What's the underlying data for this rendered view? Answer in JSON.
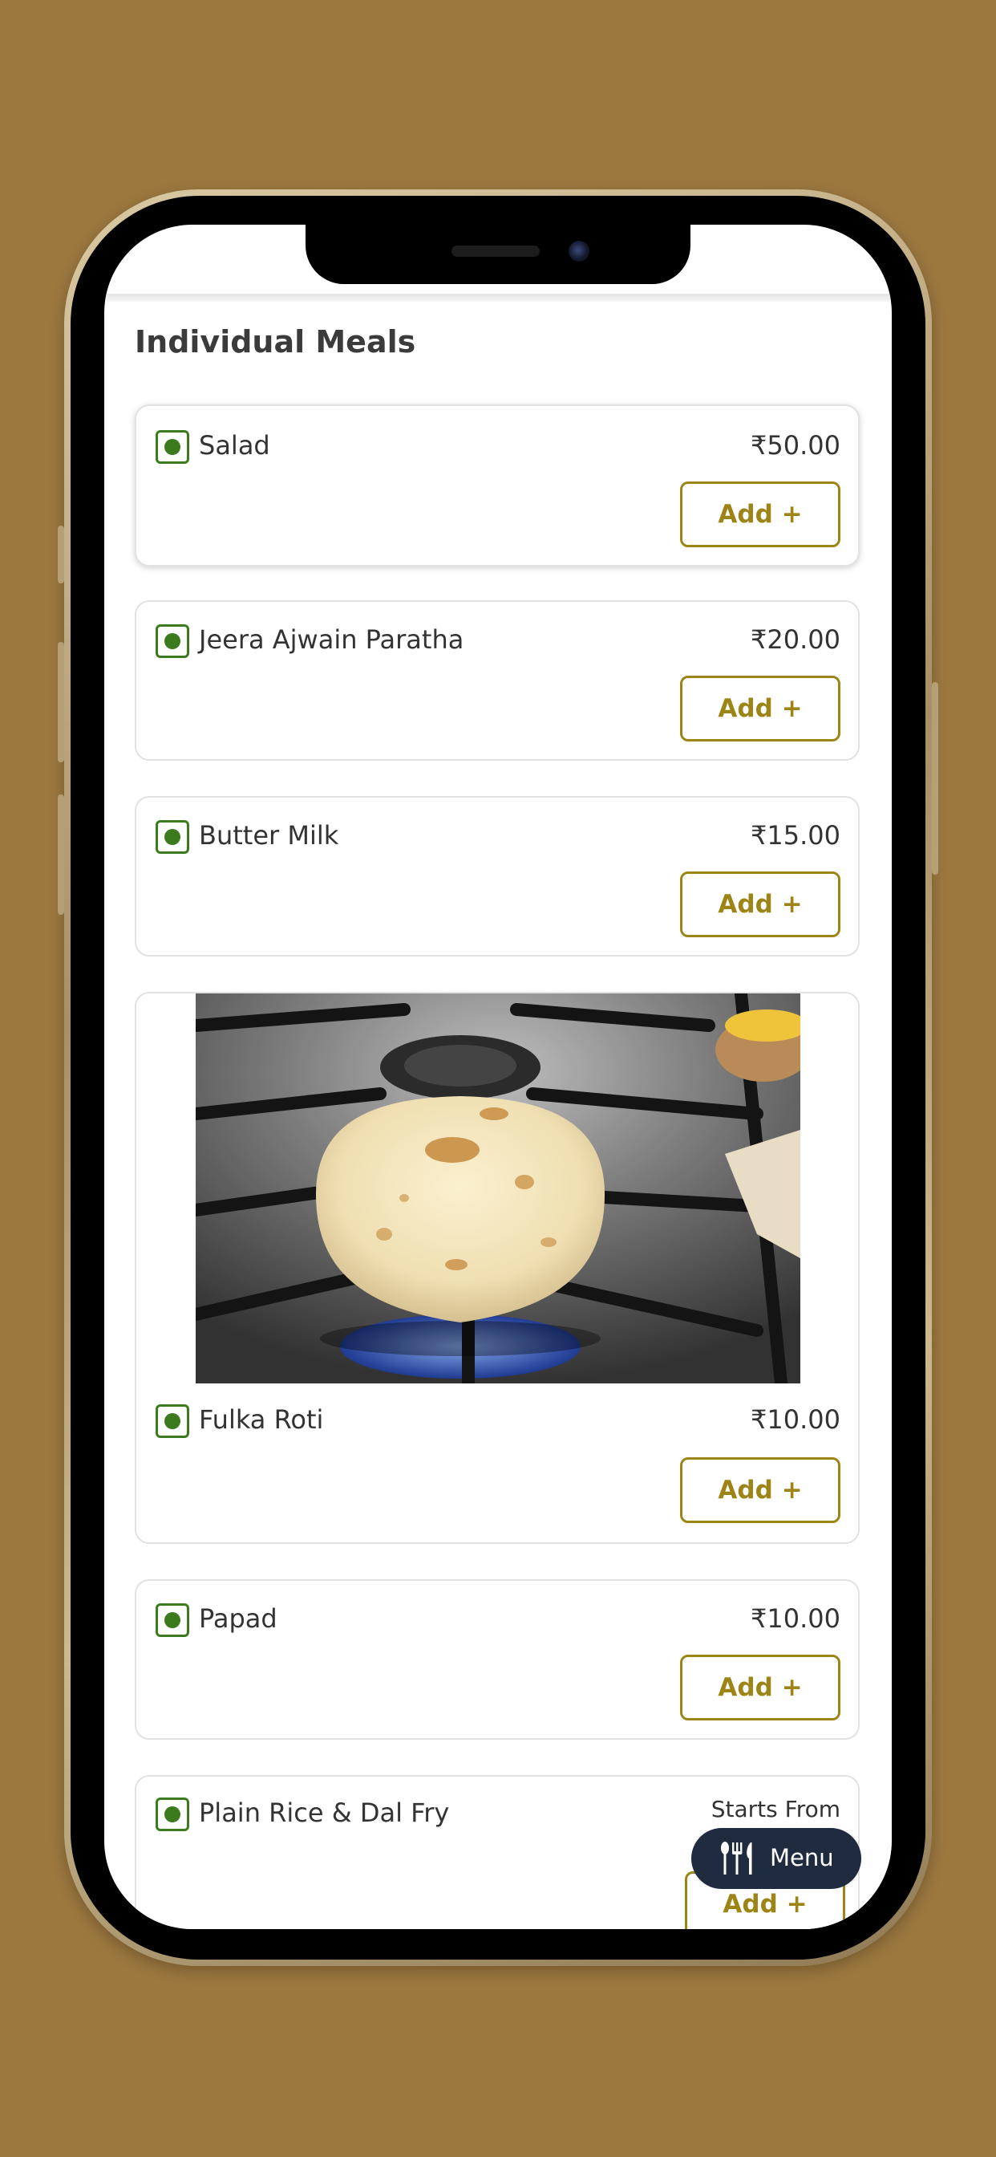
{
  "section_title": "Individual Meals",
  "items": [
    {
      "name": "Salad",
      "price": "₹50.00",
      "add_label": "Add +",
      "veg": true
    },
    {
      "name": "Jeera Ajwain Paratha",
      "price": "₹20.00",
      "add_label": "Add +",
      "veg": true
    },
    {
      "name": "Butter Milk",
      "price": "₹15.00",
      "add_label": "Add +",
      "veg": true
    },
    {
      "name": "Fulka Roti",
      "price": "₹10.00",
      "add_label": "Add +",
      "veg": true,
      "has_image": true
    },
    {
      "name": "Papad",
      "price": "₹10.00",
      "add_label": "Add +",
      "veg": true
    },
    {
      "name": "Plain Rice & Dal Fry",
      "price": "Starts From",
      "add_label": "Add +",
      "veg": true
    }
  ],
  "menu_button": {
    "label": "Menu",
    "icon": "cutlery-icon"
  },
  "icons": {
    "veg_indicator": "veg-dot-icon"
  },
  "colors": {
    "background": "#9c783f",
    "veg_green": "#3c7a1e",
    "add_button": "#9c8516",
    "menu_button_bg": "#1f2c40",
    "text": "#333333"
  }
}
